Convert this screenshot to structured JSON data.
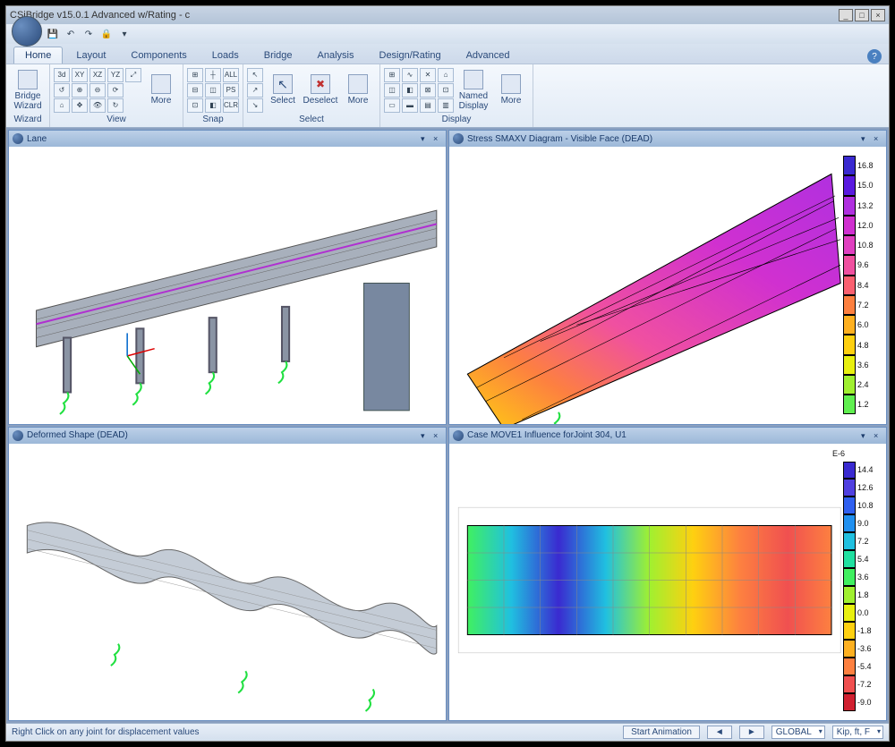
{
  "app": {
    "title": "CSiBridge v15.0.1 Advanced w/Rating  - c"
  },
  "qat": {
    "save_tip": "Save",
    "undo_tip": "Undo",
    "redo_tip": "Redo",
    "lock_tip": "Lock"
  },
  "tabs": [
    "Home",
    "Layout",
    "Components",
    "Loads",
    "Bridge",
    "Analysis",
    "Design/Rating",
    "Advanced"
  ],
  "active_tab": 0,
  "ribbon": {
    "wizard_group": {
      "label": "Wizard",
      "button": "Bridge\nWizard"
    },
    "view_group": {
      "label": "View",
      "more": "More",
      "small": [
        "3d",
        "XY",
        "XZ",
        "YZ",
        "⤢",
        "↻",
        "↺",
        "⊕",
        "⊖",
        "⟳",
        "⌂",
        "✥",
        "👁"
      ]
    },
    "snap_group": {
      "label": "Snap",
      "small": [
        "⊞",
        "┼",
        "ALL",
        "⊟",
        "◫",
        "PS",
        "⊡",
        "◧",
        "CLR"
      ]
    },
    "select_group": {
      "label": "Select",
      "select": "Select",
      "deselect": "Deselect",
      "more": "More",
      "arrows": [
        "↖",
        "↗",
        "↘"
      ]
    },
    "display_group": {
      "label": "Display",
      "named": "Named\nDisplay",
      "more": "More",
      "icons": [
        "⊞",
        "∿",
        "✕",
        "⌂",
        "◫",
        "◧",
        "⊠",
        "⊡",
        "▭",
        "▬",
        "▤",
        "▥"
      ]
    }
  },
  "viewports": {
    "tl": "Lane",
    "tr": "Stress SMAXV Diagram - Visible Face   (DEAD)",
    "bl": "Deformed Shape  (DEAD)",
    "br": "Case MOVE1 Influence forJoint 304,  U1"
  },
  "legend_tr": {
    "values": [
      "16.8",
      "15.0",
      "13.2",
      "12.0",
      "10.8",
      "9.6",
      "8.4",
      "7.2",
      "6.0",
      "4.8",
      "3.6",
      "2.4",
      "1.2"
    ],
    "colors": [
      "#3a2ad0",
      "#5a1ae0",
      "#b030e0",
      "#d030d0",
      "#e040c0",
      "#f050a0",
      "#fa6070",
      "#fd8040",
      "#feb020",
      "#fed010",
      "#e8f010",
      "#a0f030",
      "#60f050"
    ]
  },
  "legend_br": {
    "exp": "E-6",
    "values": [
      "14.4",
      "12.6",
      "10.8",
      "9.0",
      "7.2",
      "5.4",
      "3.6",
      "1.8",
      "0.0",
      "-1.8",
      "-3.6",
      "-5.4",
      "-7.2",
      "-9.0"
    ],
    "colors": [
      "#3a2ad0",
      "#5040e0",
      "#3060f0",
      "#2090f0",
      "#20c0e0",
      "#20e0a0",
      "#40f060",
      "#a0f030",
      "#e8f010",
      "#fed010",
      "#feb020",
      "#fd8040",
      "#f05050",
      "#d02030"
    ]
  },
  "status": {
    "hint": "Right Click on any joint for displacement values",
    "start_anim": "Start Animation",
    "coord": "GLOBAL",
    "units": "Kip, ft, F"
  },
  "chart_data": [
    {
      "type": "heatmap",
      "title": "Stress SMAXV Diagram - Visible Face (DEAD)",
      "unit": "",
      "scale_min": 1.2,
      "scale_max": 16.8,
      "step": 1.2,
      "colorbar": [
        "16.8",
        "15.0",
        "13.2",
        "12.0",
        "10.8",
        "9.6",
        "8.4",
        "7.2",
        "6.0",
        "4.8",
        "3.6",
        "2.4",
        "1.2"
      ]
    },
    {
      "type": "heatmap",
      "title": "Case MOVE1 Influence for Joint 304, U1",
      "unit": "E-6",
      "scale_min": -9.0,
      "scale_max": 14.4,
      "step": 1.8,
      "colorbar": [
        "14.4",
        "12.6",
        "10.8",
        "9.0",
        "7.2",
        "5.4",
        "3.6",
        "1.8",
        "0.0",
        "-1.8",
        "-3.6",
        "-5.4",
        "-7.2",
        "-9.0"
      ]
    }
  ]
}
